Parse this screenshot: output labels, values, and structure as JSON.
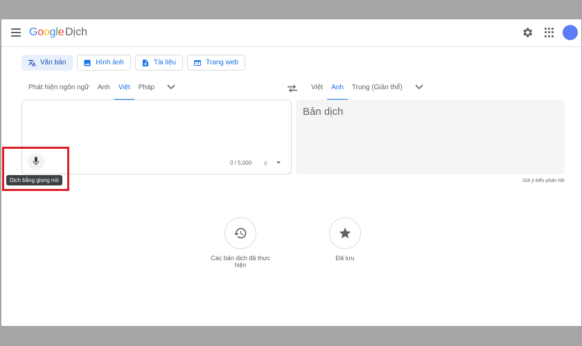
{
  "header": {
    "logo_letters": [
      "G",
      "o",
      "o",
      "g",
      "l",
      "e"
    ],
    "product": "Dịch"
  },
  "modes": [
    {
      "label": "Văn bản",
      "icon": "translate-icon",
      "active": true
    },
    {
      "label": "Hình ảnh",
      "icon": "image-icon",
      "active": false
    },
    {
      "label": "Tài liệu",
      "icon": "document-icon",
      "active": false
    },
    {
      "label": "Trang web",
      "icon": "web-icon",
      "active": false
    }
  ],
  "source_languages": [
    {
      "label": "Phát hiện ngôn ngữ",
      "active": false
    },
    {
      "label": "Anh",
      "active": false
    },
    {
      "label": "Việt",
      "active": true
    },
    {
      "label": "Pháp",
      "active": false
    }
  ],
  "target_languages": [
    {
      "label": "Việt",
      "active": false
    },
    {
      "label": "Anh",
      "active": true
    },
    {
      "label": "Trung (Giản thể)",
      "active": false
    }
  ],
  "source": {
    "value": "",
    "char_count": "0 / 5,000",
    "mic_tooltip": "Dịch bằng giọng nói",
    "keyboard_glyph": "ê"
  },
  "target": {
    "placeholder": "Bản dịch",
    "feedback": "Gửi ý kiến phản hồi"
  },
  "actions": {
    "history": "Các bản dịch đã thực hiện",
    "saved": "Đã lưu"
  },
  "colors": {
    "accent": "#1a73e8",
    "highlight": "#dc1f26",
    "avatar": "#5b7cf6"
  }
}
